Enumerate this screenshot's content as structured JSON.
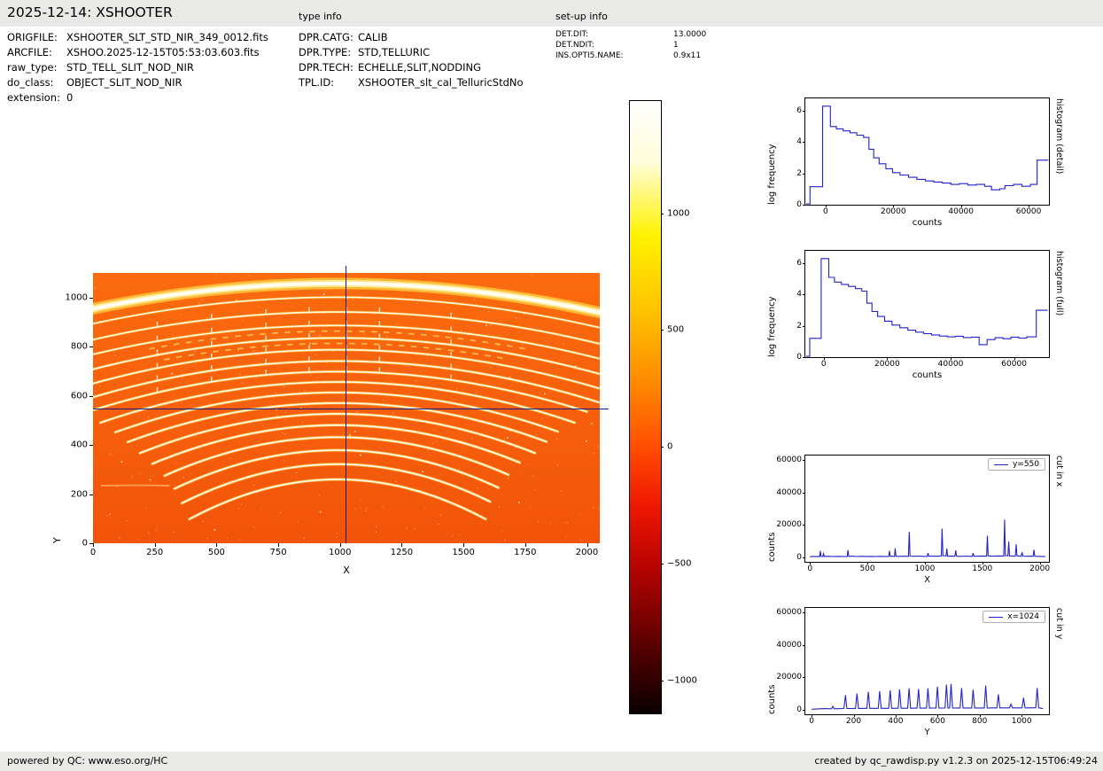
{
  "header": {
    "title": "2025-12-14: XSHOOTER",
    "type_info_label": "type info",
    "setup_info_label": "set-up info"
  },
  "file_info": {
    "rows": [
      {
        "label": "ORIGFILE:",
        "value": "XSHOOTER_SLT_STD_NIR_349_0012.fits"
      },
      {
        "label": "ARCFILE:",
        "value": "XSHOO.2025-12-15T05:53:03.603.fits"
      },
      {
        "label": "raw_type:",
        "value": "STD_TELL_SLIT_NOD_NIR"
      },
      {
        "label": "do_class:",
        "value": "OBJECT_SLIT_NOD_NIR"
      },
      {
        "label": "extension:",
        "value": "0"
      }
    ]
  },
  "type_info": {
    "rows": [
      {
        "label": "DPR.CATG:",
        "value": "CALIB"
      },
      {
        "label": "DPR.TYPE:",
        "value": "STD,TELLURIC"
      },
      {
        "label": "DPR.TECH:",
        "value": "ECHELLE,SLIT,NODDING"
      },
      {
        "label": "TPL.ID:",
        "value": "XSHOOTER_slt_cal_TelluricStdNo"
      }
    ]
  },
  "setup_info": {
    "rows": [
      {
        "label": "DET.DIT:",
        "value": "13.0000"
      },
      {
        "label": "DET.NDIT:",
        "value": "1"
      },
      {
        "label": "INS.OPTI5.NAME:",
        "value": "0.9x11"
      }
    ]
  },
  "footer": {
    "left": "powered by QC: www.eso.org/HC",
    "right": "created by qc_rawdisp.py v1.2.3 on 2025-12-15T06:49:24"
  },
  "colors": {
    "line": "#2222cc",
    "crosshair": "#1a1a80",
    "bar_bg": "#e9e9e7"
  },
  "chart_data": [
    {
      "type": "heatmap",
      "id": "raw_frame",
      "el": "plot-main",
      "xlabel": "X",
      "ylabel": "Y",
      "xlim": [
        0,
        2052
      ],
      "ylim": [
        0,
        1101
      ],
      "xticks": [
        0,
        250,
        500,
        750,
        1000,
        1250,
        1500,
        1750,
        2000
      ],
      "yticks": [
        0,
        200,
        400,
        600,
        800,
        1000
      ],
      "crosshair": {
        "x": 1024,
        "y": 550
      },
      "apex_x": 990,
      "noise_dots": 320,
      "slit_ticks": [
        260,
        480,
        700,
        875,
        1025,
        1160,
        1450
      ],
      "colors": {
        "bg_top": "#fb6b0e",
        "bg_bottom": "#f2540a"
      },
      "orders": [
        {
          "apex": 1058,
          "k": 0.000105,
          "half": 1100,
          "w": 13,
          "band": true
        },
        {
          "apex": 1002,
          "k": 0.00011,
          "half": 1100,
          "w": 3
        },
        {
          "apex": 942,
          "k": 0.000115,
          "half": 1100,
          "w": 3.2
        },
        {
          "apex": 887,
          "k": 0.00012,
          "half": 1100,
          "w": 3.2
        },
        {
          "apex": 836,
          "k": 0.00013,
          "half": 1100,
          "w": 3.4
        },
        {
          "apex": 788,
          "k": 0.00014,
          "half": 1100,
          "w": 3.4
        },
        {
          "apex": 742,
          "k": 0.00015,
          "half": 1080,
          "w": 3.5
        },
        {
          "apex": 699,
          "k": 0.00016,
          "half": 1020,
          "w": 3.5
        },
        {
          "apex": 657,
          "k": 0.00018,
          "half": 960,
          "w": 3.6
        },
        {
          "apex": 614,
          "k": 0.0002,
          "half": 900,
          "w": 3.6
        },
        {
          "apex": 571,
          "k": 0.00022,
          "half": 850,
          "w": 3.7
        },
        {
          "apex": 527,
          "k": 0.00025,
          "half": 800,
          "w": 3.7
        },
        {
          "apex": 481,
          "k": 0.00028,
          "half": 750,
          "w": 3.8
        },
        {
          "apex": 432,
          "k": 0.00032,
          "half": 700,
          "w": 3.8
        },
        {
          "apex": 379,
          "k": 0.00036,
          "half": 660,
          "w": 3.8
        },
        {
          "apex": 322,
          "k": 0.0004,
          "half": 630,
          "w": 3.8
        },
        {
          "apex": 260,
          "k": 0.00045,
          "half": 600,
          "w": 3.8
        },
        {
          "apex": 864,
          "k": 0.000125,
          "half": 760,
          "w": 2.2,
          "dash": true
        },
        {
          "apex": 814,
          "k": 0.000135,
          "half": 700,
          "w": 2.2,
          "dash": true
        },
        {
          "apex": 236,
          "k": 9e-05,
          "half": 140,
          "w": 2,
          "ax": 175,
          "faint": true
        }
      ]
    },
    {
      "type": "colorbar",
      "id": "colorbar",
      "el": "colorbar",
      "vmin": -1140,
      "vmax": 1480,
      "ticks": [
        1000,
        500,
        0,
        -500,
        -1000
      ],
      "stops": [
        [
          "0%",
          "#ffffff"
        ],
        [
          "10%",
          "#fffdda"
        ],
        [
          "22%",
          "#fff200"
        ],
        [
          "34%",
          "#ffc400"
        ],
        [
          "46%",
          "#ff8a00"
        ],
        [
          "56%",
          "#ff5000"
        ],
        [
          "66%",
          "#f01800"
        ],
        [
          "76%",
          "#b80300"
        ],
        [
          "88%",
          "#600000"
        ],
        [
          "100%",
          "#0a0000"
        ]
      ]
    },
    {
      "type": "line",
      "id": "hist_detail",
      "el": "plot-hist-detail",
      "side_label": "histogram (detail)",
      "xlabel": "counts",
      "ylabel": "log frequency",
      "xlim": [
        -6000,
        66000
      ],
      "ylim": [
        0,
        6.8
      ],
      "xticks": [
        0,
        20000,
        40000,
        60000
      ],
      "yticks": [
        0,
        2,
        4,
        6
      ],
      "steps": [
        [
          -5800,
          0.05
        ],
        [
          -4600,
          1.15
        ],
        [
          -900,
          6.3
        ],
        [
          1400,
          5.0
        ],
        [
          3200,
          4.85
        ],
        [
          5200,
          4.72
        ],
        [
          7200,
          4.6
        ],
        [
          9200,
          4.45
        ],
        [
          11200,
          4.3
        ],
        [
          12800,
          3.55
        ],
        [
          14200,
          3.0
        ],
        [
          15800,
          2.62
        ],
        [
          17800,
          2.3
        ],
        [
          19800,
          2.05
        ],
        [
          22000,
          1.9
        ],
        [
          24500,
          1.75
        ],
        [
          27000,
          1.62
        ],
        [
          29500,
          1.52
        ],
        [
          32000,
          1.45
        ],
        [
          34500,
          1.38
        ],
        [
          37000,
          1.3
        ],
        [
          39500,
          1.35
        ],
        [
          42000,
          1.26
        ],
        [
          44500,
          1.3
        ],
        [
          47000,
          1.18
        ],
        [
          49000,
          0.95
        ],
        [
          51500,
          1.02
        ],
        [
          53000,
          1.22
        ],
        [
          55500,
          1.3
        ],
        [
          58000,
          1.18
        ],
        [
          60500,
          1.3
        ],
        [
          62500,
          2.85
        ],
        [
          65800,
          2.85
        ]
      ]
    },
    {
      "type": "line",
      "id": "hist_full",
      "el": "plot-hist-full",
      "side_label": "histogram (full)",
      "xlabel": "counts",
      "ylabel": "log frequency",
      "xlim": [
        -5800,
        71000
      ],
      "ylim": [
        0,
        6.8
      ],
      "xticks": [
        0,
        20000,
        40000,
        60000
      ],
      "yticks": [
        0,
        2,
        4,
        6
      ],
      "steps": [
        [
          -5600,
          0.05
        ],
        [
          -4400,
          1.2
        ],
        [
          -800,
          6.3
        ],
        [
          1600,
          5.1
        ],
        [
          3400,
          4.8
        ],
        [
          5600,
          4.65
        ],
        [
          7800,
          4.52
        ],
        [
          10000,
          4.38
        ],
        [
          12000,
          4.22
        ],
        [
          13600,
          3.45
        ],
        [
          15200,
          2.92
        ],
        [
          17000,
          2.6
        ],
        [
          19200,
          2.3
        ],
        [
          21500,
          2.05
        ],
        [
          24000,
          1.88
        ],
        [
          26500,
          1.72
        ],
        [
          29000,
          1.6
        ],
        [
          31500,
          1.5
        ],
        [
          34000,
          1.42
        ],
        [
          36500,
          1.35
        ],
        [
          39000,
          1.3
        ],
        [
          41500,
          1.34
        ],
        [
          44000,
          1.25
        ],
        [
          46500,
          1.28
        ],
        [
          49000,
          0.8
        ],
        [
          51500,
          1.12
        ],
        [
          54000,
          1.24
        ],
        [
          56500,
          1.18
        ],
        [
          59000,
          1.28
        ],
        [
          61500,
          1.22
        ],
        [
          64000,
          1.3
        ],
        [
          67000,
          3.0
        ],
        [
          70600,
          3.0
        ]
      ]
    },
    {
      "type": "line",
      "id": "cut_x",
      "el": "plot-cut-x",
      "legend": "y=550",
      "side_label": "cut in x",
      "xlabel": "X",
      "ylabel": "counts",
      "xlim": [
        -40,
        2080
      ],
      "ylim": [
        -3000,
        63000
      ],
      "xticks": [
        0,
        500,
        1000,
        1500,
        2000
      ],
      "yticks": [
        0,
        20000,
        40000,
        60000
      ],
      "points": [
        [
          0,
          150
        ],
        [
          20,
          420
        ],
        [
          45,
          260
        ],
        [
          70,
          350
        ],
        [
          85,
          310
        ],
        [
          90,
          3900
        ],
        [
          96,
          420
        ],
        [
          112,
          300
        ],
        [
          118,
          2100
        ],
        [
          125,
          350
        ],
        [
          160,
          450
        ],
        [
          200,
          310
        ],
        [
          240,
          430
        ],
        [
          280,
          330
        ],
        [
          325,
          310
        ],
        [
          331,
          4300
        ],
        [
          338,
          390
        ],
        [
          370,
          500
        ],
        [
          410,
          310
        ],
        [
          450,
          480
        ],
        [
          490,
          330
        ],
        [
          530,
          430
        ],
        [
          570,
          310
        ],
        [
          610,
          450
        ],
        [
          650,
          360
        ],
        [
          686,
          400
        ],
        [
          692,
          3900
        ],
        [
          699,
          420
        ],
        [
          724,
          500
        ],
        [
          736,
          360
        ],
        [
          742,
          5400
        ],
        [
          749,
          450
        ],
        [
          780,
          410
        ],
        [
          820,
          500
        ],
        [
          857,
          420
        ],
        [
          864,
          15600
        ],
        [
          871,
          600
        ],
        [
          900,
          460
        ],
        [
          940,
          550
        ],
        [
          980,
          390
        ],
        [
          1021,
          430
        ],
        [
          1028,
          2500
        ],
        [
          1035,
          460
        ],
        [
          1070,
          600
        ],
        [
          1110,
          510
        ],
        [
          1143,
          620
        ],
        [
          1150,
          17600
        ],
        [
          1157,
          820
        ],
        [
          1184,
          700
        ],
        [
          1191,
          5200
        ],
        [
          1198,
          520
        ],
        [
          1240,
          610
        ],
        [
          1262,
          470
        ],
        [
          1269,
          4100
        ],
        [
          1276,
          510
        ],
        [
          1310,
          420
        ],
        [
          1350,
          560
        ],
        [
          1390,
          460
        ],
        [
          1413,
          420
        ],
        [
          1420,
          2500
        ],
        [
          1427,
          440
        ],
        [
          1460,
          510
        ],
        [
          1500,
          610
        ],
        [
          1537,
          520
        ],
        [
          1544,
          13100
        ],
        [
          1551,
          720
        ],
        [
          1590,
          520
        ],
        [
          1640,
          660
        ],
        [
          1687,
          620
        ],
        [
          1694,
          23200
        ],
        [
          1701,
          920
        ],
        [
          1723,
          720
        ],
        [
          1730,
          9600
        ],
        [
          1737,
          710
        ],
        [
          1770,
          620
        ],
        [
          1788,
          710
        ],
        [
          1795,
          7900
        ],
        [
          1802,
          660
        ],
        [
          1839,
          520
        ],
        [
          1846,
          2900
        ],
        [
          1853,
          560
        ],
        [
          1890,
          470
        ],
        [
          1930,
          510
        ],
        [
          1943,
          460
        ],
        [
          1950,
          4400
        ],
        [
          1957,
          490
        ],
        [
          1990,
          420
        ],
        [
          2030,
          360
        ],
        [
          2050,
          320
        ]
      ]
    },
    {
      "type": "line",
      "id": "cut_y",
      "el": "plot-cut-y",
      "legend": "x=1024",
      "side_label": "cut in y",
      "xlabel": "Y",
      "ylabel": "counts",
      "xlim": [
        -30,
        1130
      ],
      "ylim": [
        -3000,
        63000
      ],
      "xticks": [
        0,
        200,
        400,
        600,
        800,
        1000
      ],
      "yticks": [
        0,
        20000,
        40000,
        60000
      ],
      "points": [
        [
          0,
          160
        ],
        [
          30,
          360
        ],
        [
          60,
          510
        ],
        [
          95,
          410
        ],
        [
          101,
          1900
        ],
        [
          108,
          430
        ],
        [
          140,
          510
        ],
        [
          154,
          610
        ],
        [
          161,
          8900
        ],
        [
          168,
          560
        ],
        [
          200,
          610
        ],
        [
          209,
          660
        ],
        [
          216,
          9900
        ],
        [
          223,
          610
        ],
        [
          255,
          660
        ],
        [
          263,
          710
        ],
        [
          270,
          10900
        ],
        [
          277,
          660
        ],
        [
          310,
          710
        ],
        [
          317,
          660
        ],
        [
          324,
          11300
        ],
        [
          331,
          690
        ],
        [
          360,
          710
        ],
        [
          367,
          730
        ],
        [
          374,
          11900
        ],
        [
          381,
          710
        ],
        [
          405,
          730
        ],
        [
          412,
          760
        ],
        [
          419,
          12400
        ],
        [
          426,
          730
        ],
        [
          450,
          760
        ],
        [
          457,
          790
        ],
        [
          464,
          13100
        ],
        [
          471,
          760
        ],
        [
          495,
          790
        ],
        [
          502,
          810
        ],
        [
          509,
          12700
        ],
        [
          516,
          790
        ],
        [
          540,
          810
        ],
        [
          547,
          830
        ],
        [
          554,
          13100
        ],
        [
          561,
          810
        ],
        [
          585,
          830
        ],
        [
          592,
          860
        ],
        [
          599,
          14100
        ],
        [
          606,
          830
        ],
        [
          628,
          860
        ],
        [
          635,
          890
        ],
        [
          642,
          15400
        ],
        [
          649,
          860
        ],
        [
          657,
          890
        ],
        [
          664,
          15900
        ],
        [
          671,
          870
        ],
        [
          700,
          890
        ],
        [
          707,
          910
        ],
        [
          714,
          13300
        ],
        [
          721,
          890
        ],
        [
          755,
          910
        ],
        [
          762,
          930
        ],
        [
          769,
          12300
        ],
        [
          776,
          910
        ],
        [
          815,
          930
        ],
        [
          822,
          960
        ],
        [
          829,
          14900
        ],
        [
          836,
          930
        ],
        [
          875,
          960
        ],
        [
          882,
          970
        ],
        [
          889,
          9300
        ],
        [
          896,
          940
        ],
        [
          935,
          960
        ],
        [
          942,
          970
        ],
        [
          949,
          3300
        ],
        [
          956,
          950
        ],
        [
          995,
          970
        ],
        [
          1002,
          990
        ],
        [
          1009,
          7300
        ],
        [
          1016,
          960
        ],
        [
          1060,
          990
        ],
        [
          1067,
          1000
        ],
        [
          1074,
          13300
        ],
        [
          1081,
          970
        ],
        [
          1095,
          710
        ],
        [
          1101,
          480
        ]
      ]
    }
  ]
}
